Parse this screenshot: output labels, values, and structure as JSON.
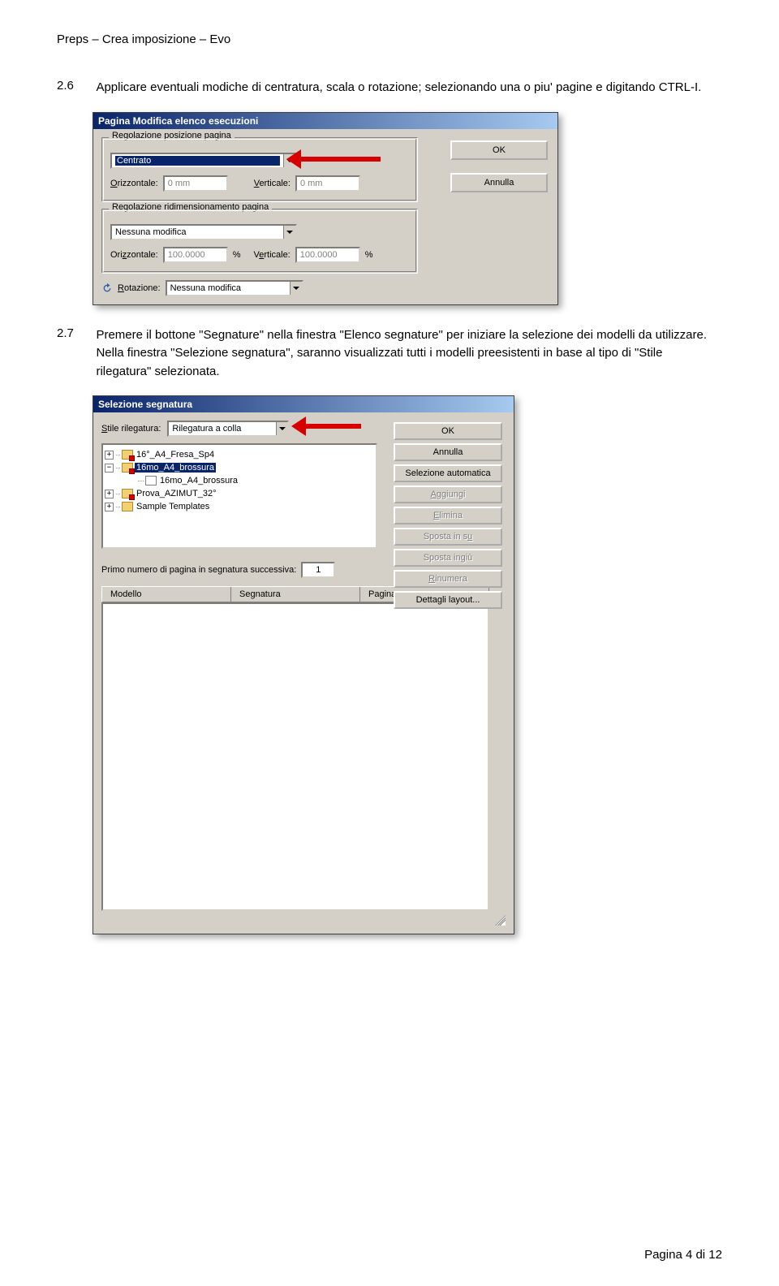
{
  "header": "Preps – Crea imposizione – Evo",
  "section26": {
    "num": "2.6",
    "text": "Applicare eventuali modiche di centratura, scala o rotazione; selezionando una o piu' pagine e digitando CTRL-I."
  },
  "section27": {
    "num": "2.7",
    "text": "Premere il bottone \"Segnature\" nella finestra \"Elenco segnature\" per iniziare la selezione dei modelli da utilizzare. Nella finestra \"Selezione segnatura\", saranno visualizzati tutti i modelli preesistenti in base al tipo di \"Stile rilegatura\" selezionata."
  },
  "dialog1": {
    "title": "Pagina Modifica elenco esecuzioni",
    "ok": "OK",
    "cancel": "Annulla",
    "group_position": {
      "title": "Regolazione posizione pagina",
      "combo_value": "Centrato",
      "horiz_label": "Orizzontale:",
      "horiz_value": "0 mm",
      "vert_label": "Verticale:",
      "vert_value": "0 mm"
    },
    "group_resize": {
      "title": "Regolazione ridimensionamento pagina",
      "combo_value": "Nessuna modifica",
      "horiz_label": "Orizzontale:",
      "horiz_value": "100.0000",
      "horiz_unit": "%",
      "vert_label": "Verticale:",
      "vert_value": "100.0000",
      "vert_unit": "%"
    },
    "rotation": {
      "label": "Rotazione:",
      "value": "Nessuna modifica"
    }
  },
  "dialog2": {
    "title": "Selezione segnatura",
    "style_label": "Stile rilegatura:",
    "style_value": "Rilegatura a colla",
    "buttons": {
      "ok": "OK",
      "cancel": "Annulla",
      "auto": "Selezione automatica",
      "add": "Aggiungi",
      "delete": "Elimina",
      "moveup": "Sposta in su",
      "movedown": "Sposta in giù",
      "renumber": "Rinumera",
      "details": "Dettagli layout..."
    },
    "tree": {
      "items": [
        {
          "exp": "+",
          "label": "16°_A4_Fresa_Sp4",
          "badge": true
        },
        {
          "exp": "-",
          "label": "16mo_A4_brossura",
          "badge": true,
          "selected": true
        },
        {
          "exp": "",
          "label": "16mo_A4_brossura",
          "badge": false,
          "child": true
        },
        {
          "exp": "+",
          "label": "Prova_AZIMUT_32°",
          "badge": true
        },
        {
          "exp": "+",
          "label": "Sample Templates",
          "badge": false
        }
      ]
    },
    "prime_label": "Primo numero di pagina in segnatura successiva:",
    "prime_value": "1",
    "columns": {
      "c1": "Modello",
      "c2": "Segnatura",
      "c3": "Pagina"
    }
  },
  "footer": "Pagina 4 di 12"
}
